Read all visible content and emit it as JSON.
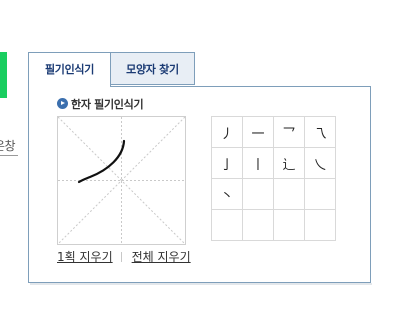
{
  "left_fragment": {
    "text": "은창"
  },
  "tabs": [
    {
      "label": "필기인식기",
      "active": true
    },
    {
      "label": "모양자 찾기",
      "active": false
    }
  ],
  "panel": {
    "section_title": "한자 필기인식기",
    "candidates": [
      [
        "丿",
        "一",
        "乛",
        "乁"
      ],
      [
        "亅",
        "丨",
        "辶",
        "乀"
      ],
      [
        "丶",
        "",
        "",
        ""
      ],
      [
        "",
        "",
        "",
        ""
      ]
    ],
    "links": {
      "undo_label": "1획 지우기",
      "clear_label": "전체 지우기"
    }
  },
  "colors": {
    "accent_green": "#19ce60",
    "tab_border": "#7e9eba",
    "tab_text": "#1b3b74",
    "bullet": "#3b6fae"
  }
}
